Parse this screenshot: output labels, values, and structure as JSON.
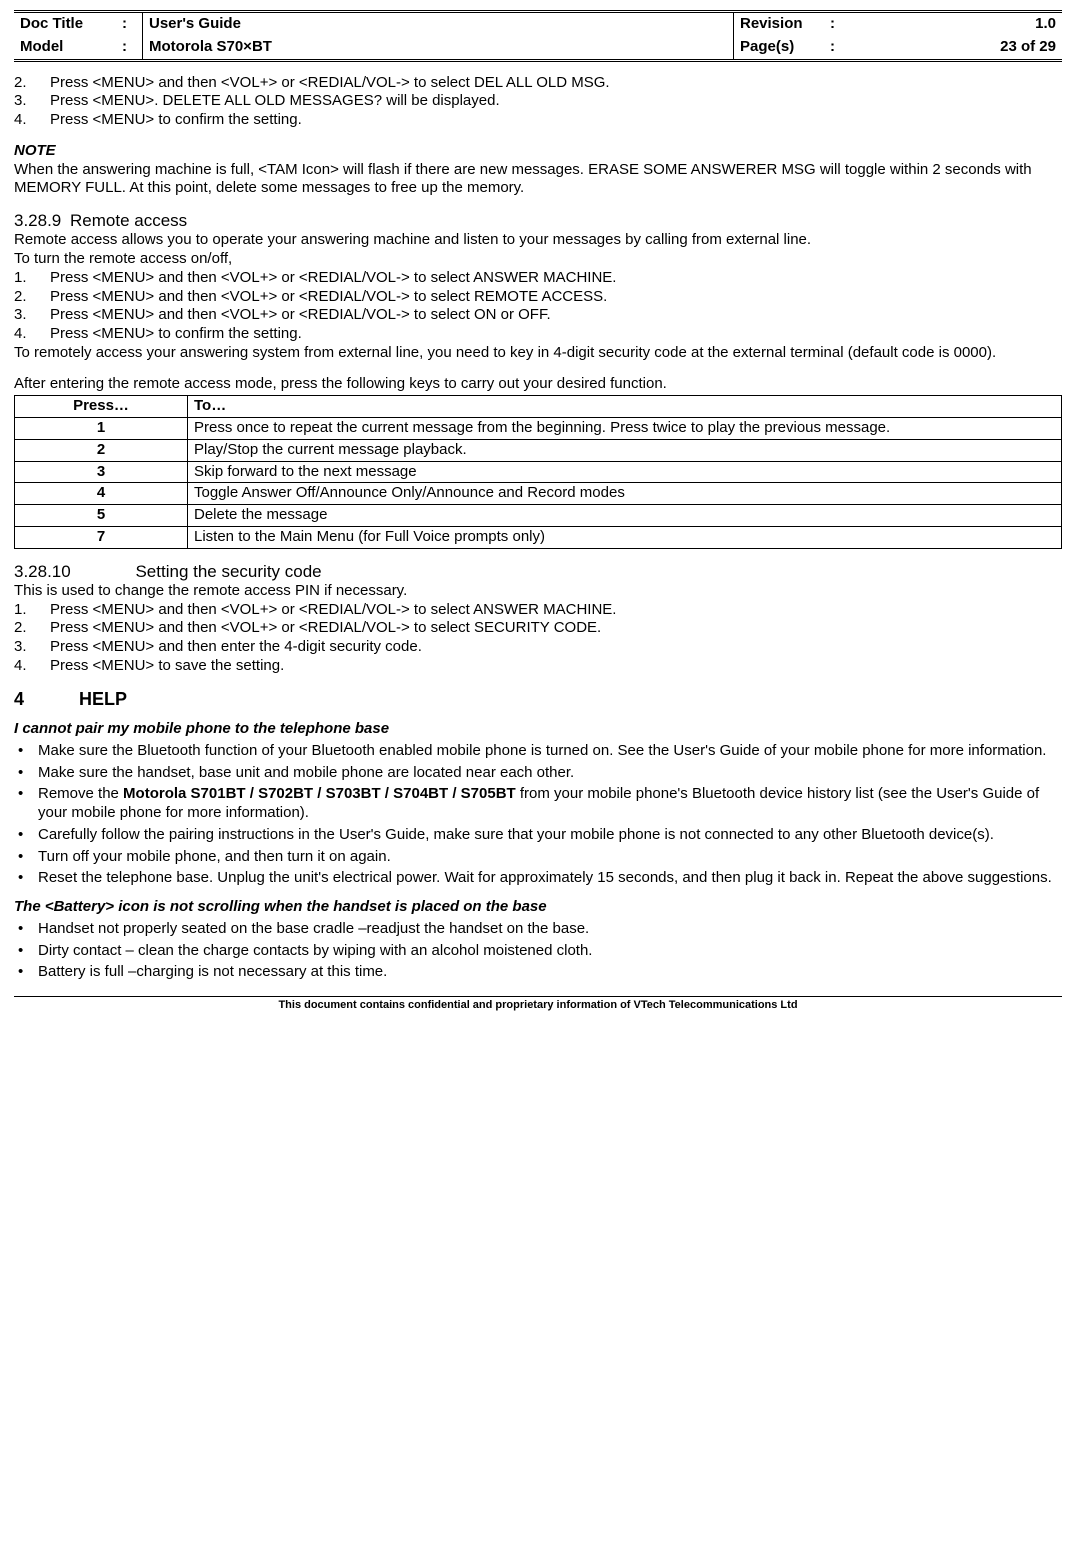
{
  "header": {
    "docTitleLabel": "Doc Title",
    "docTitleValue": "User's Guide",
    "revisionLabel": "Revision",
    "revisionValue": "1.0",
    "modelLabel": "Model",
    "modelValue": "Motorola S70×BT",
    "pagesLabel": "Page(s)",
    "pagesValue": "23 of 29",
    "colon": ":"
  },
  "topList": {
    "items": [
      {
        "n": "2.",
        "t": "Press <MENU> and then <VOL+> or <REDIAL/VOL-> to select DEL ALL OLD MSG."
      },
      {
        "n": "3.",
        "t": "Press <MENU>. DELETE ALL OLD MESSAGES? will be displayed."
      },
      {
        "n": "4.",
        "t": "Press <MENU> to confirm the setting."
      }
    ]
  },
  "note": {
    "heading": "NOTE",
    "body": "When the answering machine is full, <TAM Icon> will flash if there are new messages. ERASE SOME ANSWERER MSG will toggle within 2 seconds with MEMORY FULL. At this point, delete some messages to free up the memory."
  },
  "sec3289": {
    "num": "3.28.9",
    "title": "Remote access",
    "intro1": "Remote access allows you to operate your answering machine and listen to your messages by calling from external line.",
    "intro2": "To turn the remote access on/off,",
    "items": [
      {
        "n": "1.",
        "t": "Press <MENU> and then <VOL+> or <REDIAL/VOL-> to select ANSWER MACHINE."
      },
      {
        "n": "2.",
        "t": "Press <MENU> and then <VOL+> or <REDIAL/VOL-> to select REMOTE ACCESS."
      },
      {
        "n": "3.",
        "t": "Press <MENU> and then <VOL+> or <REDIAL/VOL-> to select ON or OFF."
      },
      {
        "n": "4.",
        "t": "Press <MENU> to confirm the setting."
      }
    ],
    "outro1": "To remotely access your answering system from external line, you need to key in 4-digit security code at the external terminal (default code is 0000).",
    "outro2": "After entering the remote access mode, press the following keys to carry out your desired function."
  },
  "pressTable": {
    "headPress": "Press…",
    "headTo": "To…",
    "rows": [
      {
        "p": "1",
        "t": "Press once to repeat the current message from the beginning. Press twice to play the previous message."
      },
      {
        "p": "2",
        "t": "Play/Stop the current message playback."
      },
      {
        "p": "3",
        "t": "Skip forward to the next message"
      },
      {
        "p": "4",
        "t": "Toggle Answer Off/Announce Only/Announce and Record modes"
      },
      {
        "p": "5",
        "t": "Delete the message"
      },
      {
        "p": "7",
        "t": "Listen to the Main Menu (for Full Voice prompts only)"
      }
    ]
  },
  "sec32810": {
    "num": "3.28.10",
    "title": "Setting the security code",
    "intro": "This is used to change the remote access PIN if necessary.",
    "items": [
      {
        "n": "1.",
        "t": "Press <MENU> and then <VOL+> or <REDIAL/VOL-> to select ANSWER MACHINE."
      },
      {
        "n": "2.",
        "t": "Press <MENU> and then <VOL+> or <REDIAL/VOL-> to select SECURITY CODE."
      },
      {
        "n": "3.",
        "t": "Press <MENU> and then enter the 4-digit security code."
      },
      {
        "n": "4.",
        "t": "Press <MENU> to save the setting."
      }
    ]
  },
  "help": {
    "num": "4",
    "title": "HELP",
    "group1": {
      "heading": "I cannot pair my mobile phone to the telephone base",
      "bullets": [
        {
          "pre": "Make sure the Bluetooth function of your Bluetooth enabled mobile phone is turned on. See  the User's Guide of your mobile phone for more information."
        },
        {
          "pre": "Make sure the handset, base unit and mobile phone are located near each other."
        },
        {
          "pre": "Remove the ",
          "strong": "Motorola S701BT / S702BT / S703BT / S704BT / S705BT",
          "post": " from your mobile phone's Bluetooth device history list (see the User's Guide of your mobile phone for more information)."
        },
        {
          "pre": "Carefully follow the pairing instructions in the User's Guide, make sure that your mobile phone is not connected to any other Bluetooth device(s)."
        },
        {
          "pre": "Turn off your mobile phone, and then turn it on again."
        },
        {
          "pre": "Reset the telephone base. Unplug the unit's electrical power. Wait for approximately 15 seconds, and then plug it back in. Repeat the above suggestions."
        }
      ]
    },
    "group2": {
      "heading": "The <Battery> icon is not scrolling when the handset is placed on the base",
      "bullets": [
        {
          "pre": "Handset not properly seated on the base cradle –readjust the handset on the base."
        },
        {
          "pre": "Dirty contact – clean the charge contacts by wiping with an alcohol moistened cloth."
        },
        {
          "pre": "Battery is full –charging is not necessary at this time."
        }
      ]
    }
  },
  "footer": "This document contains confidential and proprietary information of VTech Telecommunications Ltd"
}
